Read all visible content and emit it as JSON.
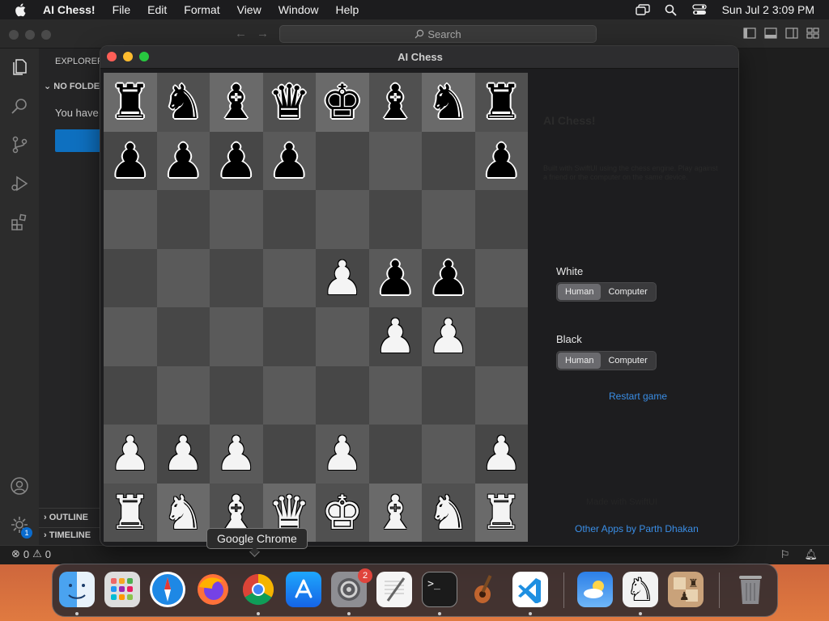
{
  "menubar": {
    "app_name": "AI Chess!",
    "items": [
      "File",
      "Edit",
      "Format",
      "View",
      "Window",
      "Help"
    ],
    "clock": "Sun Jul 2  3:09 PM"
  },
  "vscode": {
    "search_placeholder": "Search",
    "explorer_title": "EXPLORER",
    "no_folder": "NO FOLDER OPENED",
    "message": "You have not yet opened a folder.",
    "outline": "OUTLINE",
    "timeline": "TIMELINE",
    "settings_badge": "1",
    "status_errors": "0",
    "status_warnings": "0"
  },
  "chess_window": {
    "title": "AI Chess",
    "panel": {
      "app_title": "AI Chess!",
      "description": "Built with SwiftUI using the chess engine. Play against a friend or the computer on the same device.",
      "white_label": "White",
      "black_label": "Black",
      "human_label": "Human",
      "computer_label": "Computer",
      "white_selected": "Human",
      "black_selected": "Human",
      "restart": "Restart game",
      "footer_faint": "Made with SwiftUI",
      "other_apps": "Other Apps by Parth Dhakan"
    },
    "board": [
      [
        "bR",
        "bN",
        "bB",
        "bQ",
        "bK",
        "bB",
        "bN",
        "bR"
      ],
      [
        "bP",
        "bP",
        "bP",
        "bP",
        "",
        "",
        "",
        "bP"
      ],
      [
        "",
        "",
        "",
        "",
        "",
        "",
        "",
        ""
      ],
      [
        "",
        "",
        "",
        "",
        "wP",
        "bP",
        "bP",
        ""
      ],
      [
        "",
        "",
        "",
        "",
        "",
        "wP",
        "wP",
        ""
      ],
      [
        "",
        "",
        "",
        "",
        "",
        "",
        "",
        ""
      ],
      [
        "wP",
        "wP",
        "wP",
        "",
        "wP",
        "",
        "",
        "wP"
      ],
      [
        "wR",
        "wN",
        "wB",
        "wQ",
        "wK",
        "wB",
        "wN",
        "wR"
      ]
    ]
  },
  "dock": {
    "tooltip": "Google Chrome",
    "apps": [
      "Finder",
      "Launchpad",
      "Safari",
      "Firefox",
      "Google Chrome",
      "App Store",
      "System Settings",
      "TextEdit",
      "Terminal",
      "GarageBand",
      "Visual Studio Code",
      "Weather",
      "AI Chess",
      "Chess",
      "Trash"
    ],
    "settings_badge": "2"
  },
  "colors": {
    "accent_link": "#3a8ee6",
    "board_light": "#5a5a5a",
    "board_dark": "#474747"
  }
}
